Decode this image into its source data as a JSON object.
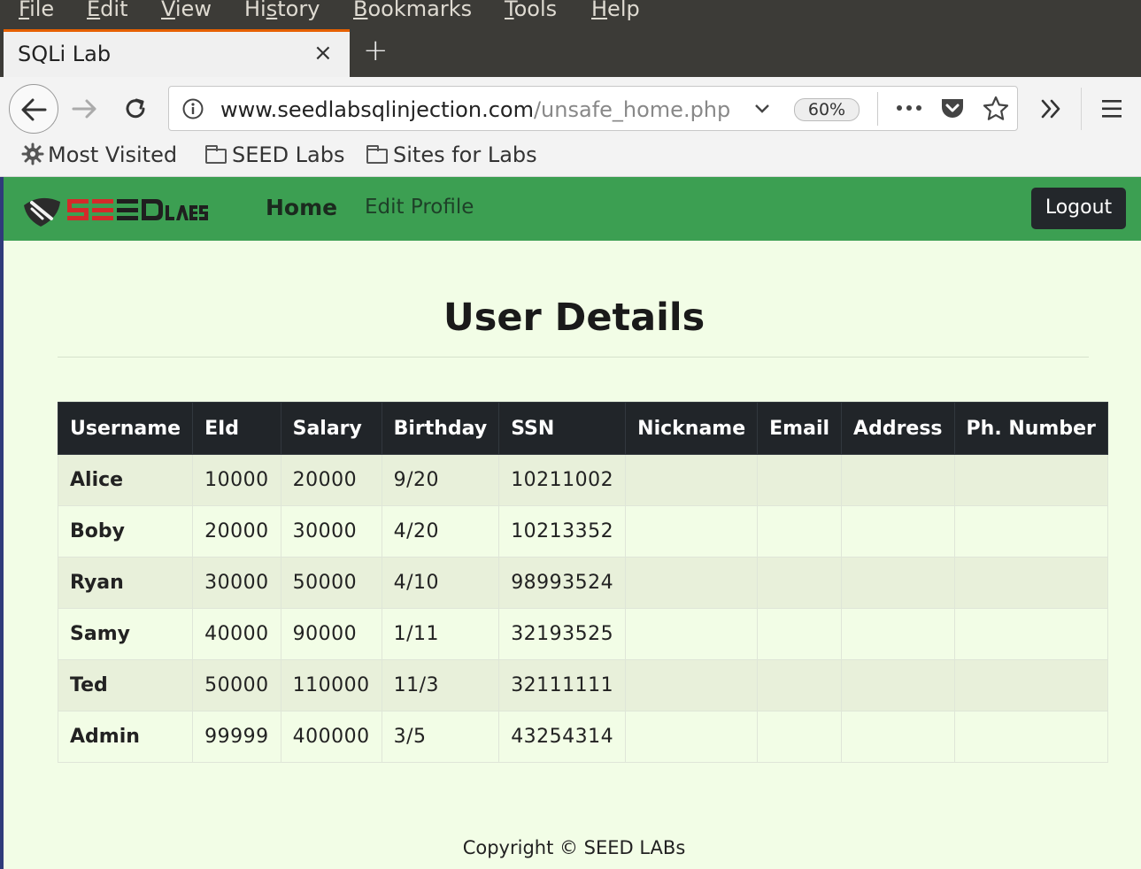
{
  "menubar": {
    "items": [
      {
        "first": "F",
        "rest": "ile"
      },
      {
        "first": "E",
        "rest": "dit"
      },
      {
        "first": "V",
        "rest": "iew"
      },
      {
        "first": "Hi",
        "ul": "s",
        "rest": "tory"
      },
      {
        "first": "B",
        "rest": "ookmarks"
      },
      {
        "first": "T",
        "rest": "ools"
      },
      {
        "first": "H",
        "rest": "elp"
      }
    ]
  },
  "tab": {
    "title": "SQLi Lab",
    "close": "×"
  },
  "toolbar": {
    "url_host": "www.seedlabsqlinjection.com",
    "url_path": "/unsafe_home.php",
    "zoom": "60%"
  },
  "bookmarks": {
    "most_visited": "Most Visited",
    "items": [
      "SEED Labs",
      "Sites for Labs"
    ]
  },
  "site_nav": {
    "home": "Home",
    "edit_profile": "Edit Profile",
    "logout": "Logout",
    "logo_text": "SEED LABS"
  },
  "main": {
    "title": "User Details",
    "table": {
      "headers": [
        "Username",
        "EId",
        "Salary",
        "Birthday",
        "SSN",
        "Nickname",
        "Email",
        "Address",
        "Ph. Number"
      ],
      "rows": [
        [
          "Alice",
          "10000",
          "20000",
          "9/20",
          "10211002",
          "",
          "",
          "",
          ""
        ],
        [
          "Boby",
          "20000",
          "30000",
          "4/20",
          "10213352",
          "",
          "",
          "",
          ""
        ],
        [
          "Ryan",
          "30000",
          "50000",
          "4/10",
          "98993524",
          "",
          "",
          "",
          ""
        ],
        [
          "Samy",
          "40000",
          "90000",
          "1/11",
          "32193525",
          "",
          "",
          "",
          ""
        ],
        [
          "Ted",
          "50000",
          "110000",
          "11/3",
          "32111111",
          "",
          "",
          "",
          ""
        ],
        [
          "Admin",
          "99999",
          "400000",
          "3/5",
          "43254314",
          "",
          "",
          "",
          ""
        ]
      ]
    }
  },
  "footer": {
    "text": "Copyright © SEED LABs"
  }
}
